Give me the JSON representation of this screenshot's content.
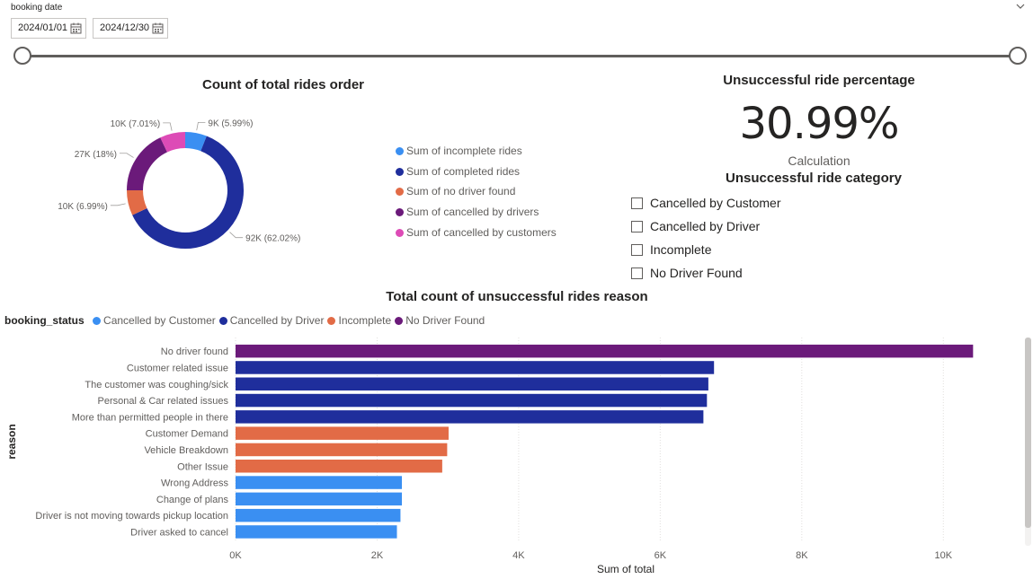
{
  "slicer": {
    "title": "booking date",
    "start_date": "2024/01/01",
    "end_date": "2024/12/30"
  },
  "kpi": {
    "title": "Unsuccessful ride percentage",
    "value": "30.99%",
    "subtitle": "Calculation"
  },
  "category_slicer": {
    "title": "Unsuccessful ride category",
    "items": [
      "Cancelled by Customer",
      "Cancelled by Driver",
      "Incomplete",
      "No Driver Found"
    ]
  },
  "colors": {
    "light_blue": "#3a8ff2",
    "dark_blue": "#1f2e9c",
    "orange": "#e26b46",
    "purple": "#6b1a7a",
    "pink": "#dd4bb6"
  },
  "chart_data": [
    {
      "type": "pie",
      "title": "Count of total rides order",
      "labels": [
        "Sum of incomplete rides",
        "Sum of completed rides",
        "Sum of no driver found",
        "Sum of cancelled by drivers",
        "Sum of cancelled by customers"
      ],
      "values": [
        5.99,
        62.02,
        6.99,
        18,
        7.01
      ],
      "data_labels": [
        "9K (5.99%)",
        "92K (62.02%)",
        "10K (6.99%)",
        "27K (18%)",
        "10K (7.01%)"
      ],
      "colors": [
        "#3a8ff2",
        "#1f2e9c",
        "#e26b46",
        "#6b1a7a",
        "#dd4bb6"
      ],
      "legend_position": "right"
    },
    {
      "type": "bar",
      "orientation": "horizontal",
      "title": "Total count of unsuccessful rides reason",
      "xlabel": "Sum of total",
      "ylabel": "reason",
      "legend_title": "booking_status",
      "legend": [
        "Cancelled by Customer",
        "Cancelled by Driver",
        "Incomplete",
        "No Driver Found"
      ],
      "legend_colors": [
        "#3a8ff2",
        "#1f2e9c",
        "#e26b46",
        "#6b1a7a"
      ],
      "categories": [
        "No driver found",
        "Customer related issue",
        "The customer was coughing/sick",
        "Personal & Car related issues",
        "More than permitted people in there",
        "Customer Demand",
        "Vehicle Breakdown",
        "Other Issue",
        "Wrong Address",
        "Change of plans",
        "Driver is not moving towards pickup location",
        "Driver asked to cancel"
      ],
      "values": [
        10420,
        6760,
        6680,
        6660,
        6610,
        3010,
        2990,
        2920,
        2350,
        2350,
        2330,
        2280
      ],
      "status": [
        "No Driver Found",
        "Cancelled by Driver",
        "Cancelled by Driver",
        "Cancelled by Driver",
        "Cancelled by Driver",
        "Incomplete",
        "Incomplete",
        "Incomplete",
        "Cancelled by Customer",
        "Cancelled by Customer",
        "Cancelled by Customer",
        "Cancelled by Customer"
      ],
      "xlim": [
        0,
        11000
      ],
      "xticks": [
        0,
        2000,
        4000,
        6000,
        8000,
        10000
      ],
      "xtick_labels": [
        "0K",
        "2K",
        "4K",
        "6K",
        "8K",
        "10K"
      ],
      "grid": true
    }
  ]
}
